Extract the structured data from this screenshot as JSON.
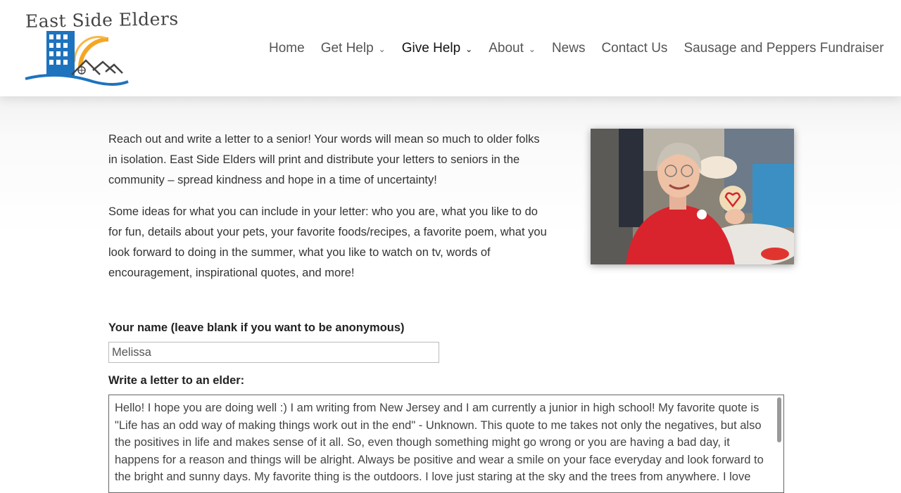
{
  "header": {
    "logo_text": "East Side Elders",
    "nav": [
      {
        "label": "Home",
        "has_dropdown": false,
        "active": false
      },
      {
        "label": "Get Help",
        "has_dropdown": true,
        "active": false
      },
      {
        "label": "Give Help",
        "has_dropdown": true,
        "active": true
      },
      {
        "label": "About",
        "has_dropdown": true,
        "active": false
      },
      {
        "label": "News",
        "has_dropdown": false,
        "active": false
      },
      {
        "label": "Contact Us",
        "has_dropdown": false,
        "active": false
      },
      {
        "label": "Sausage and Peppers Fundraiser",
        "has_dropdown": false,
        "active": false
      }
    ]
  },
  "content": {
    "paragraph1": "Reach out and write a letter to a senior!  Your words will mean so much to older folks in isolation.  East Side Elders will print and distribute your letters to seniors in the community – spread kindness and hope in a time of uncertainty!",
    "paragraph2": "Some ideas for what you can include in your letter:  who you are, what you like to do for fun, details about your pets, your favorite foods/recipes, a favorite poem, what you look forward to doing in the summer, what you like to watch on tv, words of encouragement, inspirational quotes, and more!"
  },
  "form": {
    "name_label": "Your name (leave blank if you want to be anonymous)",
    "name_value": "Melissa",
    "letter_label": "Write a letter to an elder:",
    "letter_value": "Hello! I hope you are doing well :) I am writing from New Jersey and I am currently a junior in high school! My favorite quote is \"Life has an odd way of making things work out in the end\" - Unknown. This quote to me takes not only the negatives, but also the positives in life and makes sense of it all. So, even though something might go wrong or you are having a bad day, it happens for a reason and things will be alright. Always be positive and wear a smile on your face everyday and look forward to the bright and sunny days. My favorite thing is the outdoors. I love just staring at the sky and the trees from anywhere. I love"
  },
  "colors": {
    "logo_blue": "#1e73be",
    "logo_orange": "#f5a623",
    "photo_red": "#d9242d"
  },
  "icons": {
    "chevron": "chevron-down-icon"
  }
}
